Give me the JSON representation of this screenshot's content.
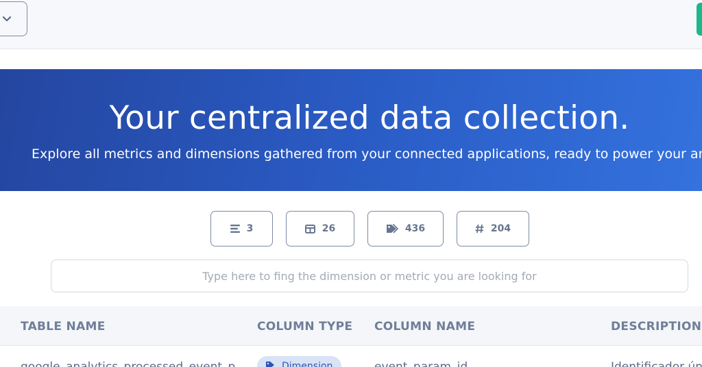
{
  "hero": {
    "title": "Your centralized data collection.",
    "subtitle": "Explore all metrics and dimensions gathered from your connected applications, ready to power your analytics"
  },
  "stats": [
    {
      "icon": "list-icon",
      "value": "3"
    },
    {
      "icon": "table-icon",
      "value": "26"
    },
    {
      "icon": "tag-icon",
      "value": "436"
    },
    {
      "icon": "hash-icon",
      "value": "204"
    }
  ],
  "search": {
    "placeholder": "Type here to fing the dimension or metric you are looking for",
    "value": ""
  },
  "table": {
    "columns": [
      "TABLE NAME",
      "COLUMN TYPE",
      "COLUMN NAME",
      "DESCRIPTION"
    ],
    "rows": [
      {
        "table_name": "google_analytics_processed_event_p",
        "column_type": "Dimension",
        "column_name": "event_param_id",
        "description": "Identificador ún"
      }
    ]
  },
  "colors": {
    "hero_start": "#2446a0",
    "hero_end": "#3472de",
    "accent_green": "#1bb88c",
    "badge_bg": "#d8e3f6"
  }
}
